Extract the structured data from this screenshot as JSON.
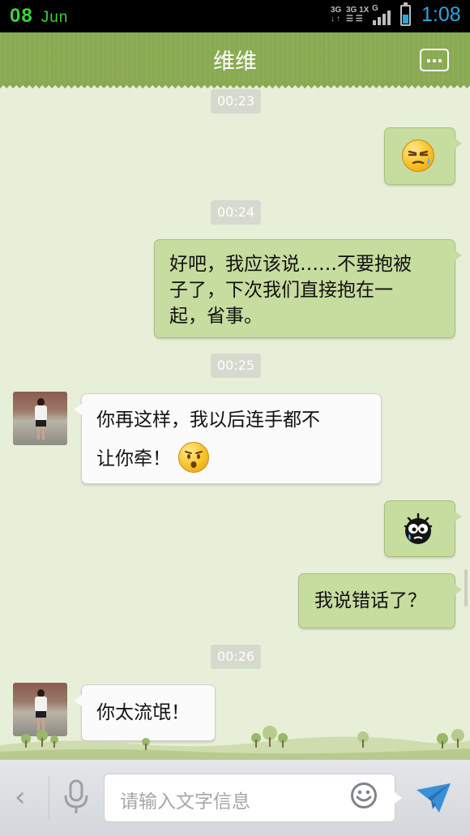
{
  "status_bar": {
    "day": "08",
    "month": "Jun",
    "network_a": "3G",
    "network_b": "3G 1X",
    "network_c": "G",
    "time": "1:08"
  },
  "header": {
    "title": "维维",
    "menu_icon": "more-dots-icon"
  },
  "chat": {
    "messages": [
      {
        "type": "timestamp",
        "text": "00:23"
      },
      {
        "type": "outgoing",
        "emoji": "sweat-face-emoji"
      },
      {
        "type": "timestamp",
        "text": "00:24"
      },
      {
        "type": "outgoing",
        "lines": [
          "好吧，我应该说……不要抱被",
          "子了，下次我们直接抱在一",
          "起，省事。"
        ]
      },
      {
        "type": "timestamp",
        "text": "00:25"
      },
      {
        "type": "incoming",
        "lines": [
          "你再这样，我以后连手都不",
          "让你牵！"
        ],
        "emoji": "surprised-face-emoji"
      },
      {
        "type": "outgoing",
        "emoji": "crying-black-ball-emoji"
      },
      {
        "type": "outgoing",
        "text": "我说错话了？"
      },
      {
        "type": "timestamp",
        "text": "00:26"
      },
      {
        "type": "incoming",
        "text": "你太流氓！"
      }
    ]
  },
  "input_bar": {
    "back_icon": "chevron-left-icon",
    "mic_icon": "microphone-icon",
    "placeholder": "请输入文字信息",
    "emoji_icon": "smiley-icon",
    "send_icon": "paper-plane-icon"
  },
  "colors": {
    "header": "#8aaa52",
    "background": "#e8efd8",
    "outgoing_bubble": "#c7dc9f",
    "incoming_bubble": "#fbfbfb",
    "clock": "#2aa7e0",
    "date": "#3fd13f"
  }
}
